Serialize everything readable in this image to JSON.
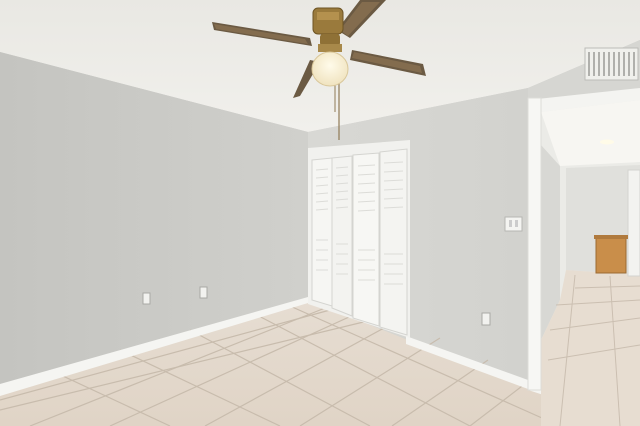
{
  "scene": {
    "subject": "empty-bedroom",
    "colors": {
      "ceiling": "#ecebe6",
      "left_wall": "#cbcbc7",
      "back_wall": "#d9d9d5",
      "right_wall": "#d3d3cf",
      "floor_tile": "#e3d8cb",
      "grout": "#c9bcae",
      "trim": "#f4f4f1",
      "fan_brass": "#9a7a3c",
      "fan_blade": "#6b5a43",
      "cabinet": "#c98e4a"
    },
    "icons": [
      "ceiling-fan-icon",
      "light-globe-icon",
      "closet-door-icon",
      "air-vent-icon",
      "light-switch-icon",
      "outlet-icon",
      "doorway-icon",
      "cabinet-icon"
    ]
  }
}
